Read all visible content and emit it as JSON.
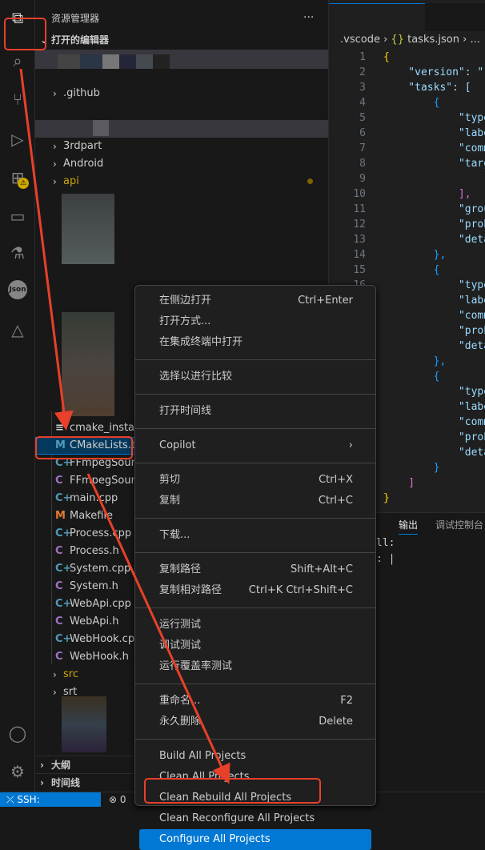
{
  "activity_bar": {
    "items": [
      "explorer-icon",
      "search-icon",
      "source-control-icon",
      "run-debug-icon",
      "extensions-icon",
      "remote-explorer-icon",
      "testing-icon",
      "json-icon",
      "cmake-icon"
    ],
    "bottom": [
      "account-icon",
      "settings-icon"
    ],
    "json_label": "Json"
  },
  "sidebar": {
    "title": "资源管理器",
    "more": "...",
    "open_editors": "打开的编辑器",
    "folders": [
      {
        "name": ".github"
      },
      {
        "name": "3rdpart"
      },
      {
        "name": "Android"
      },
      {
        "name": "api"
      }
    ],
    "files": [
      {
        "name": "cmake_install.cmake",
        "icon": "≡",
        "color": "#cccccc"
      },
      {
        "name": "CMakeLists.txt",
        "icon": "M",
        "color": "#519aba"
      },
      {
        "name": "FFmpegSource.cpp",
        "icon": "C+",
        "color": "#519aba"
      },
      {
        "name": "FFmpegSource.h",
        "icon": "C",
        "color": "#a074c4"
      },
      {
        "name": "main.cpp",
        "icon": "C+",
        "color": "#519aba"
      },
      {
        "name": "Makefile",
        "icon": "M",
        "color": "#e37933"
      },
      {
        "name": "Process.cpp",
        "icon": "C+",
        "color": "#519aba"
      },
      {
        "name": "Process.h",
        "icon": "C",
        "color": "#a074c4"
      },
      {
        "name": "System.cpp",
        "icon": "C+",
        "color": "#519aba"
      },
      {
        "name": "System.h",
        "icon": "C",
        "color": "#a074c4"
      },
      {
        "name": "WebApi.cpp",
        "icon": "C+",
        "color": "#519aba"
      },
      {
        "name": "WebApi.h",
        "icon": "C",
        "color": "#a074c4"
      },
      {
        "name": "WebHook.cpp",
        "icon": "C+",
        "color": "#519aba"
      },
      {
        "name": "WebHook.h",
        "icon": "C",
        "color": "#a074c4"
      }
    ],
    "folders_after": [
      {
        "name": "src"
      },
      {
        "name": "srt"
      }
    ],
    "outline": "大纲",
    "timeline": "时间线"
  },
  "editor": {
    "breadcrumb": {
      "folder": ".vscode",
      "file": "tasks.json",
      "more": "..."
    },
    "lines": [
      "{",
      "    \"version\": \"",
      "    \"tasks\": [",
      "        {",
      "            \"type",
      "            \"labe",
      "            \"comm",
      "            \"targ",
      "",
      "            ],",
      "            \"grou",
      "            \"prob",
      "            \"deta",
      "        },",
      "        {",
      "            \"type",
      "            \"labe",
      "            \"comm",
      "            \"prob",
      "            \"deta",
      "        },",
      "        {",
      "            \"type",
      "            \"labe",
      "            \"comm",
      "            \"prob",
      "            \"deta",
      "        }",
      "    ]",
      "}"
    ]
  },
  "panel": {
    "tabs": [
      "输出",
      "调试控制台"
    ],
    "lines": [
      "ll:",
      ": |"
    ]
  },
  "context_menu": {
    "groups": [
      [
        {
          "label": "在侧边打开",
          "key": "Ctrl+Enter"
        },
        {
          "label": "打开方式...",
          "key": ""
        },
        {
          "label": "在集成终端中打开",
          "key": ""
        }
      ],
      [
        {
          "label": "选择以进行比较",
          "key": ""
        }
      ],
      [
        {
          "label": "打开时间线",
          "key": ""
        }
      ],
      [
        {
          "label": "Copilot",
          "key": "›"
        }
      ],
      [
        {
          "label": "剪切",
          "key": "Ctrl+X"
        },
        {
          "label": "复制",
          "key": "Ctrl+C"
        }
      ],
      [
        {
          "label": "下载...",
          "key": ""
        }
      ],
      [
        {
          "label": "复制路径",
          "key": "Shift+Alt+C"
        },
        {
          "label": "复制相对路径",
          "key": "Ctrl+K Ctrl+Shift+C"
        }
      ],
      [
        {
          "label": "运行测试",
          "key": ""
        },
        {
          "label": "调试测试",
          "key": ""
        },
        {
          "label": "运行覆盖率测试",
          "key": ""
        }
      ],
      [
        {
          "label": "重命名...",
          "key": "F2"
        },
        {
          "label": "永久删除",
          "key": "Delete"
        }
      ],
      [
        {
          "label": "Build All Projects",
          "key": ""
        },
        {
          "label": "Clean All Projects",
          "key": ""
        },
        {
          "label": "Clean Rebuild All Projects",
          "key": ""
        },
        {
          "label": "Clean Reconfigure All Projects",
          "key": ""
        },
        {
          "label": "Configure All Projects",
          "key": "",
          "highlighted": true
        }
      ]
    ]
  },
  "status": {
    "remote": "SSH:",
    "errors": "0"
  },
  "colors": {
    "accent": "#0078d4",
    "annotation": "#e8402a",
    "folder_modified": "#cca700"
  }
}
